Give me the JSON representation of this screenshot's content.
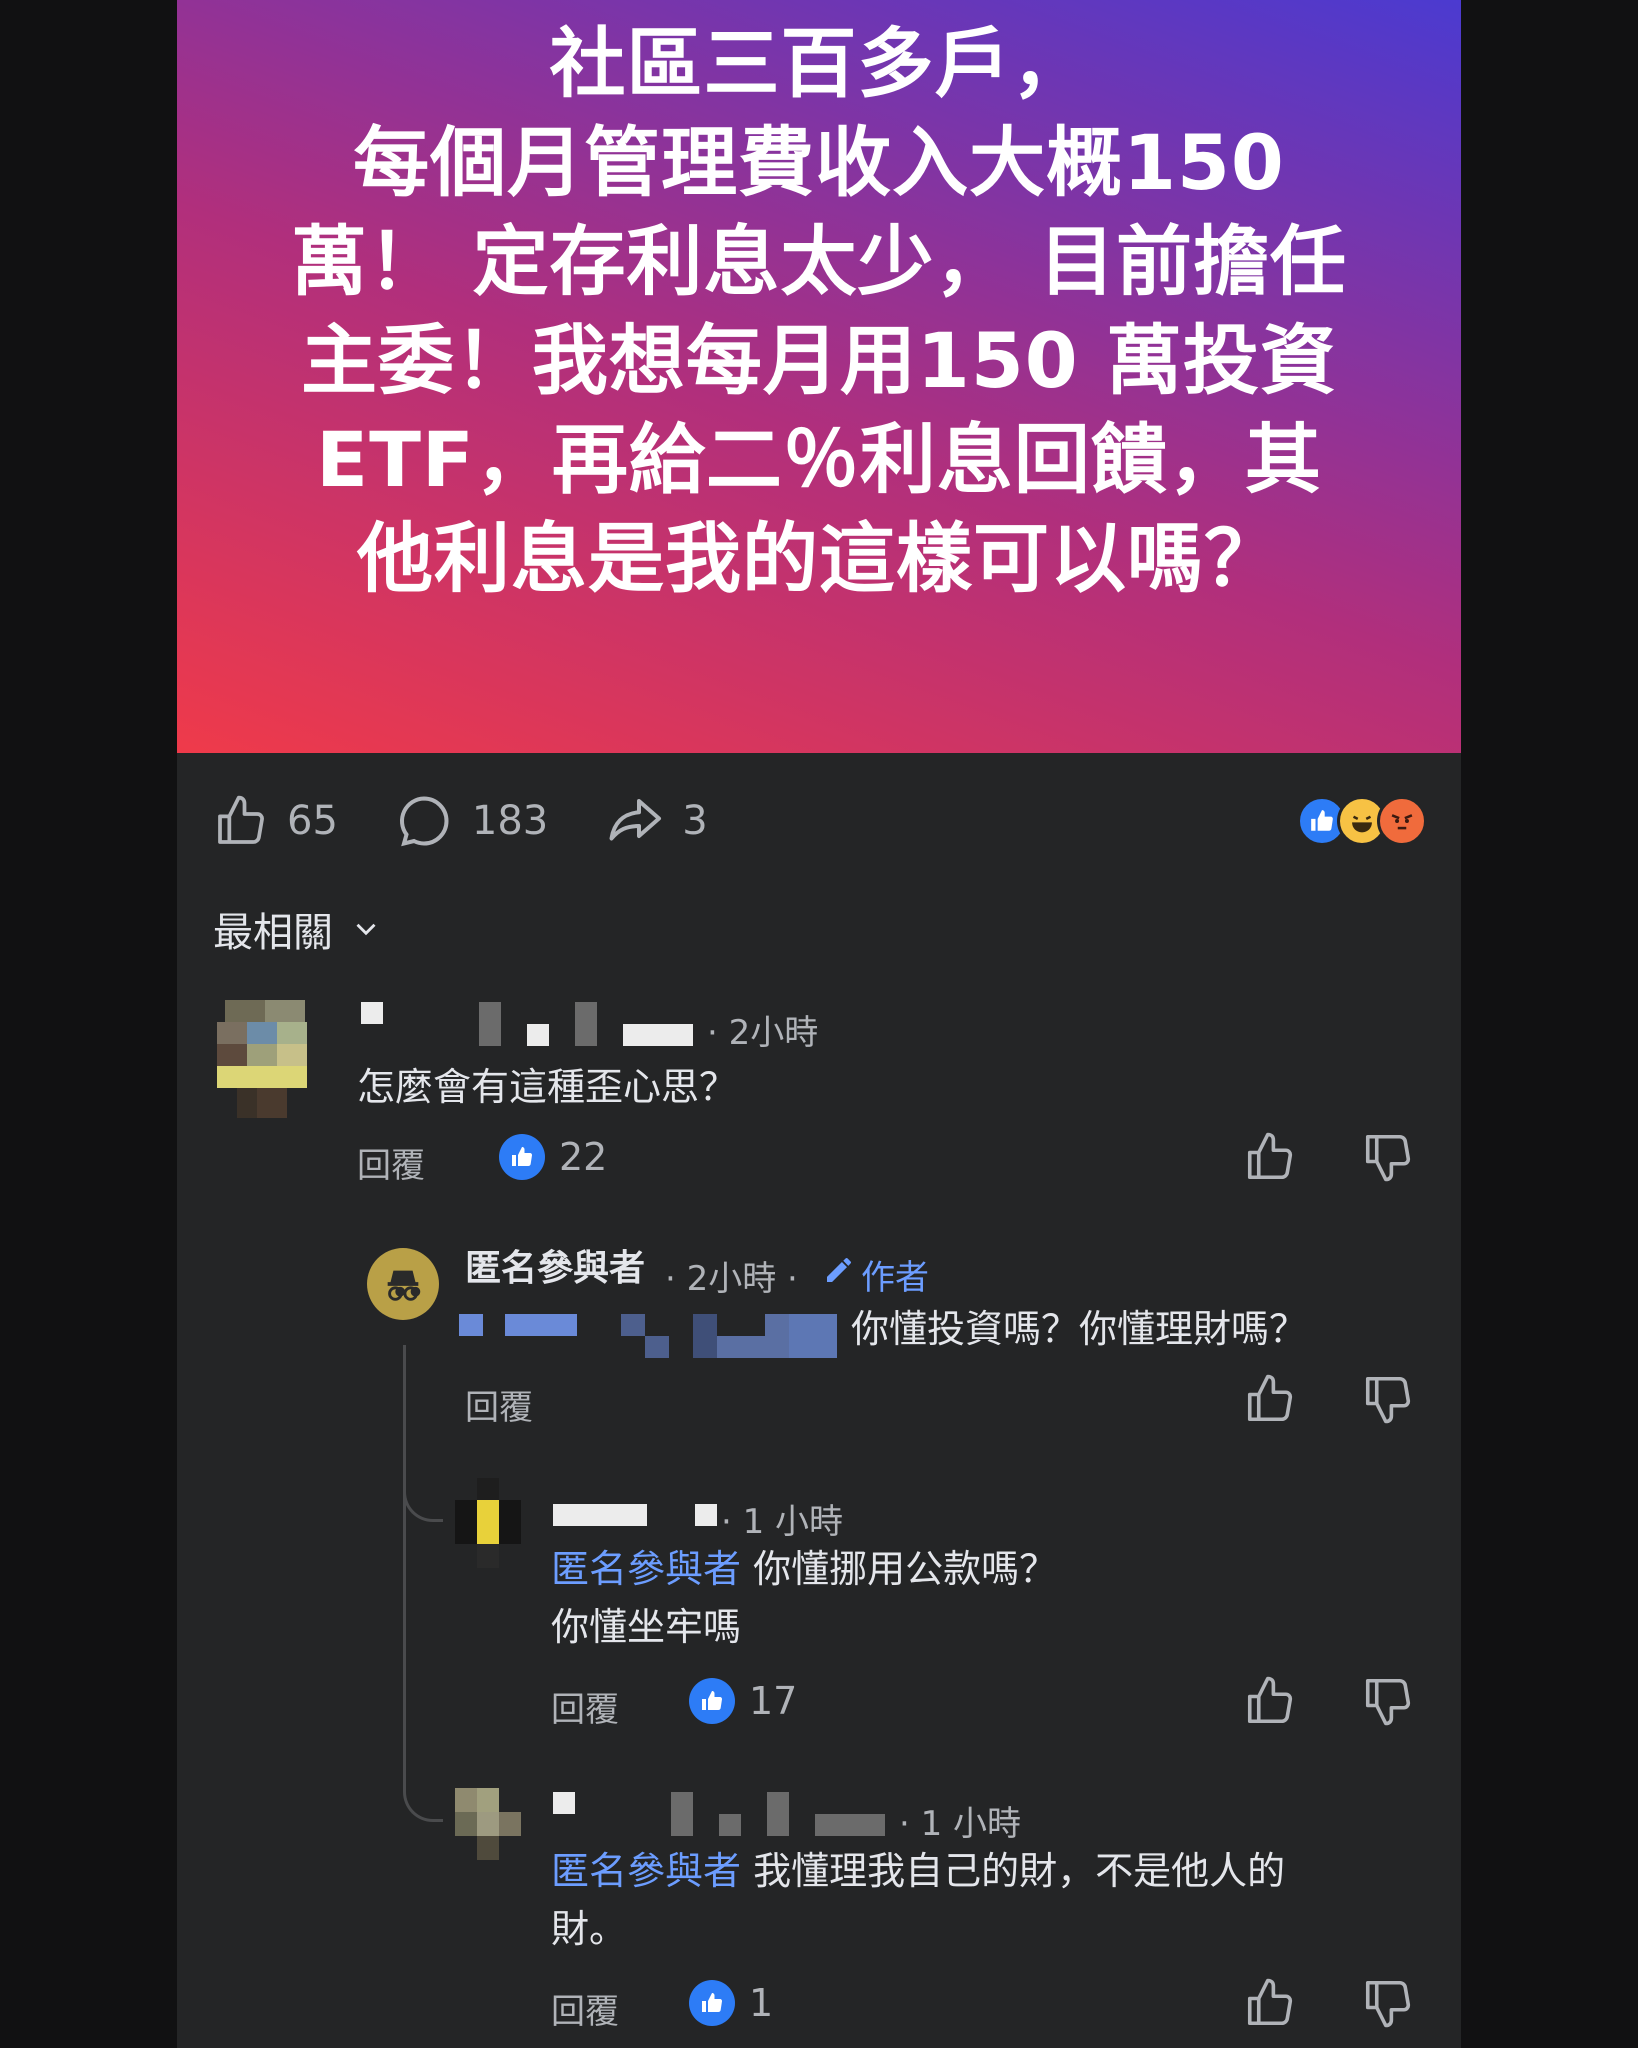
{
  "post": {
    "text": "社區三百多戶，\n每個月管理費收入大概150\n萬！ 定存利息太少， 目前擔任\n主委！我想每月用150 萬投資\nETF，再給二％利息回饋，其\n他利息是我的這樣可以嗎？"
  },
  "actions": {
    "likes": "65",
    "comments": "183",
    "shares": "3"
  },
  "sort_label": "最相關",
  "comments": [
    {
      "time": "· 2小時",
      "text": "怎麼會有這種歪心思？",
      "reply_label": "回覆",
      "likes": "22"
    },
    {
      "author": "匿名參與者",
      "time": "· 2小時 ·",
      "badge": "作者",
      "text": "你懂投資嗎？你懂理財嗎？",
      "reply_label": "回覆"
    },
    {
      "time": "· 1 小時",
      "mention": "匿名參與者",
      "text": " 你懂挪用公款嗎？\n你懂坐牢嗎",
      "reply_label": "回覆",
      "likes": "17"
    },
    {
      "time": "· 1 小時",
      "mention": "匿名參與者",
      "text": " 我懂理我自己的財，不是他人的\n財。",
      "reply_label": "回覆",
      "likes": "1"
    }
  ],
  "colors": {
    "background": "#242526",
    "accent": "#2d7cf6",
    "mention": "#6c9dff"
  }
}
